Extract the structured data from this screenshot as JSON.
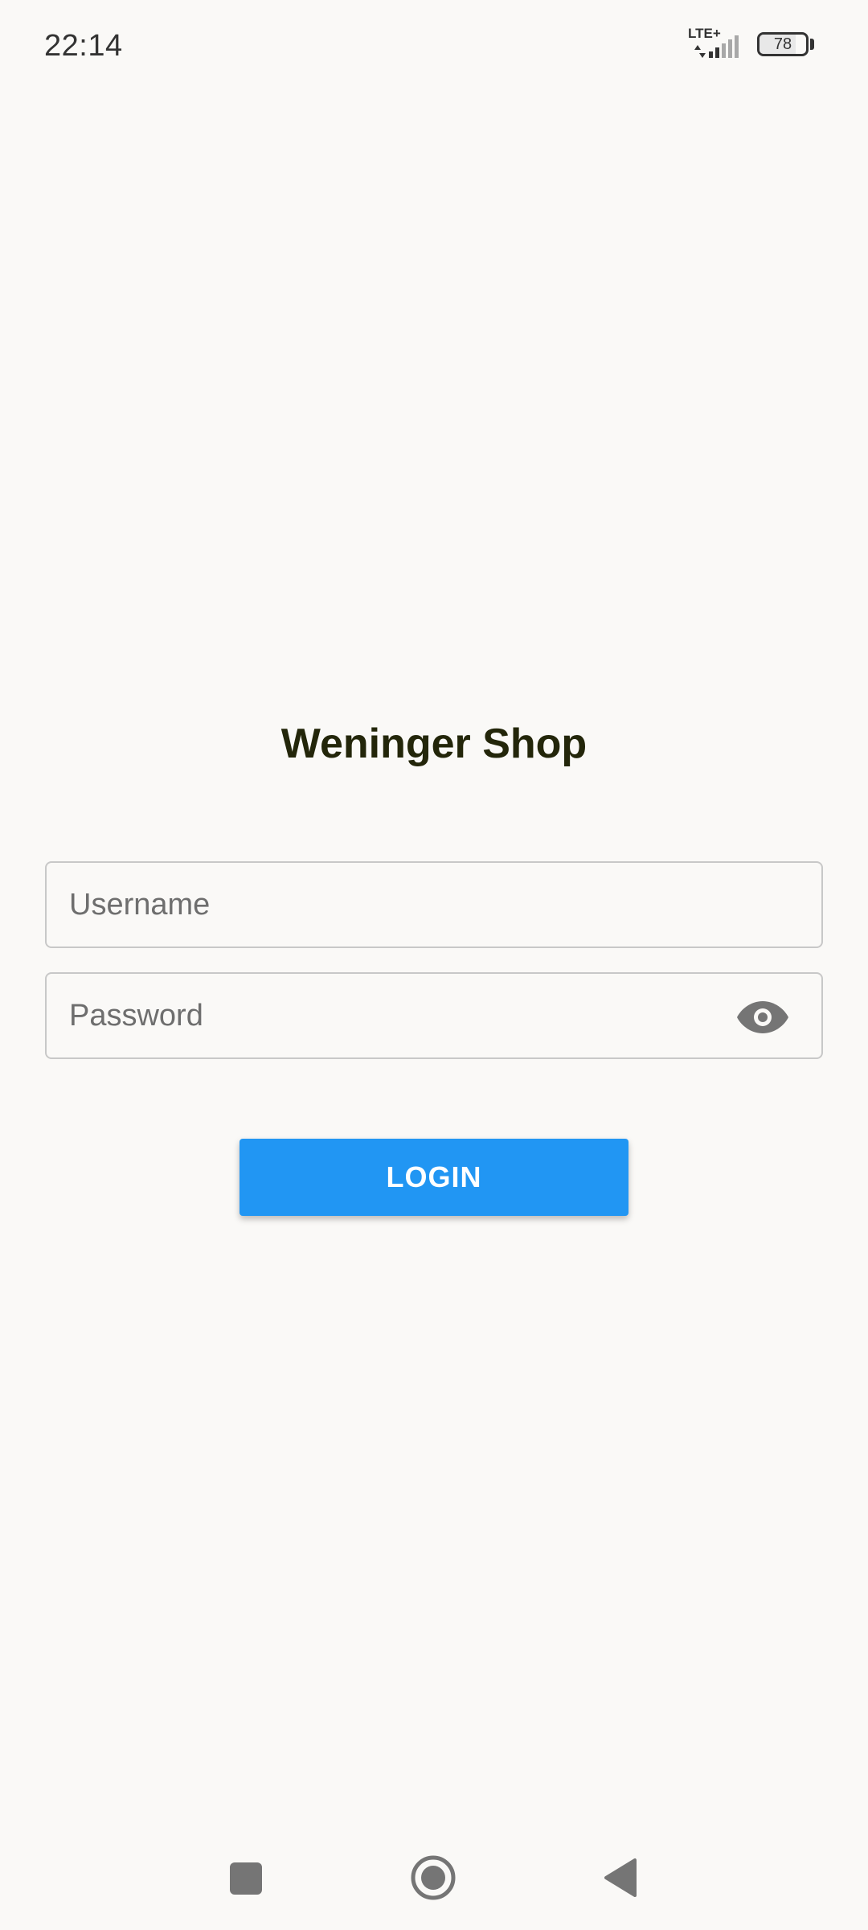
{
  "status_bar": {
    "time": "22:14",
    "network": "LTE+",
    "battery_level": "78",
    "battery_fraction": 0.78
  },
  "app": {
    "title": "Weninger Shop"
  },
  "form": {
    "username_placeholder": "Username",
    "username_value": "",
    "password_placeholder": "Password",
    "password_value": "",
    "toggle_icon": "eye-icon",
    "login_label": "LOGIN"
  },
  "nav": {
    "recents_icon": "square-icon",
    "home_icon": "circle-icon",
    "back_icon": "triangle-back-icon"
  },
  "colors": {
    "background": "#faf9f7",
    "accent": "#2196f3",
    "title": "#23260a"
  }
}
